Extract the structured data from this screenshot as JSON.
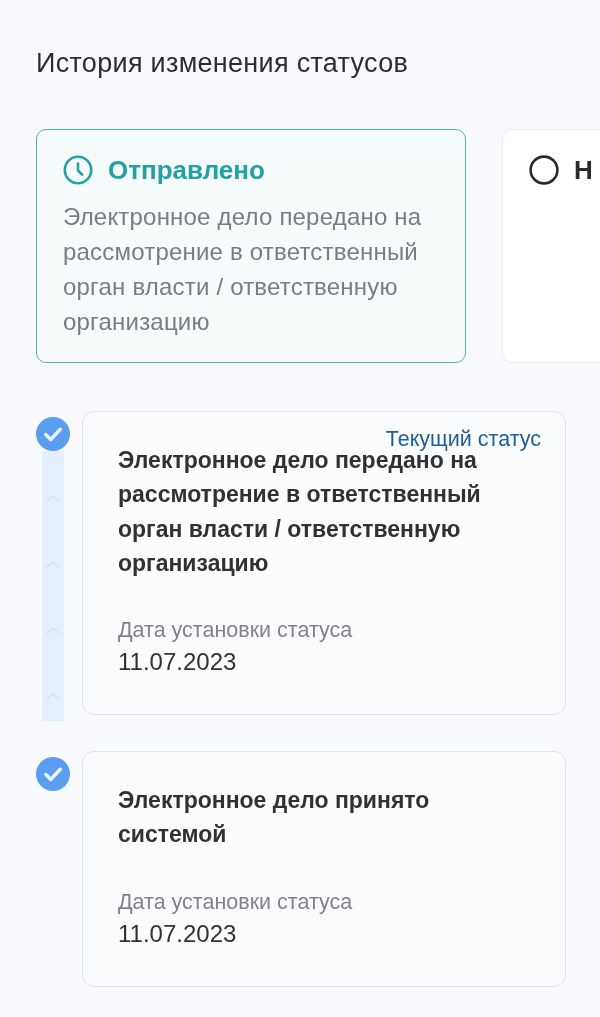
{
  "title": "История изменения статусов",
  "status_cards": [
    {
      "title": "Отправлено",
      "description": "Электронное дело передано на рассмотрение в ответственный орган власти / ответственную организацию",
      "selected": true
    },
    {
      "title": "Н",
      "selected": false
    }
  ],
  "timeline": [
    {
      "title": "Электронное дело передано на рассмотрение в ответственный орган власти / ответственную организацию",
      "badge": "Текущий статус",
      "checked": true,
      "date_label": "Дата установки статуса",
      "date": "11.07.2023"
    },
    {
      "title": "Электронное дело принято системой",
      "checked": true,
      "date_label": "Дата установки статуса",
      "date": "11.07.2023"
    }
  ]
}
